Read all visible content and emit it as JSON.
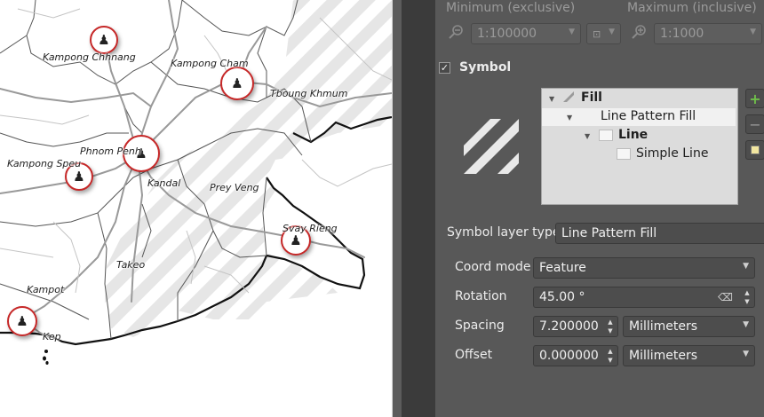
{
  "map": {
    "places": [
      {
        "name": "Kampong Chhnang"
      },
      {
        "name": "Kampong Cham"
      },
      {
        "name": "Tboung Khmum"
      },
      {
        "name": "Phnom Penh"
      },
      {
        "name": "Kampong Speu"
      },
      {
        "name": "Kandal"
      },
      {
        "name": "Prey Veng"
      },
      {
        "name": "Svay Rieng"
      },
      {
        "name": "Takeo"
      },
      {
        "name": "Kampot"
      },
      {
        "name": "Kep"
      }
    ]
  },
  "panel": {
    "scale": {
      "min_label": "Minimum (exclusive)",
      "max_label": "Maximum (inclusive)",
      "min_value": "1:100000",
      "max_value": "1:1000"
    },
    "symbol": {
      "checkbox_label": "Symbol",
      "checked": true,
      "tree": [
        {
          "label": "Fill"
        },
        {
          "label": "Line Pattern Fill"
        },
        {
          "label": "Line"
        },
        {
          "label": "Simple Line"
        }
      ]
    },
    "layer_type": {
      "label": "Symbol layer type",
      "value": "Line Pattern Fill"
    },
    "fields": {
      "coord_mode": {
        "label": "Coord mode",
        "value": "Feature"
      },
      "rotation": {
        "label": "Rotation",
        "value": "45.00 °"
      },
      "spacing": {
        "label": "Spacing",
        "value": "7.200000",
        "unit": "Millimeters"
      },
      "offset": {
        "label": "Offset",
        "value": "0.000000",
        "unit": "Millimeters"
      }
    }
  },
  "icons": [
    "zoom-out-icon",
    "zoom-in-icon",
    "current-scale-icon",
    "add-layer-icon",
    "remove-layer-icon",
    "duplicate-layer-icon",
    "clear-icon",
    "city-marker-icon"
  ],
  "colors": {
    "panel_bg": "#585858",
    "map_border": "#c62828",
    "hatch": "#e6e6e6"
  }
}
